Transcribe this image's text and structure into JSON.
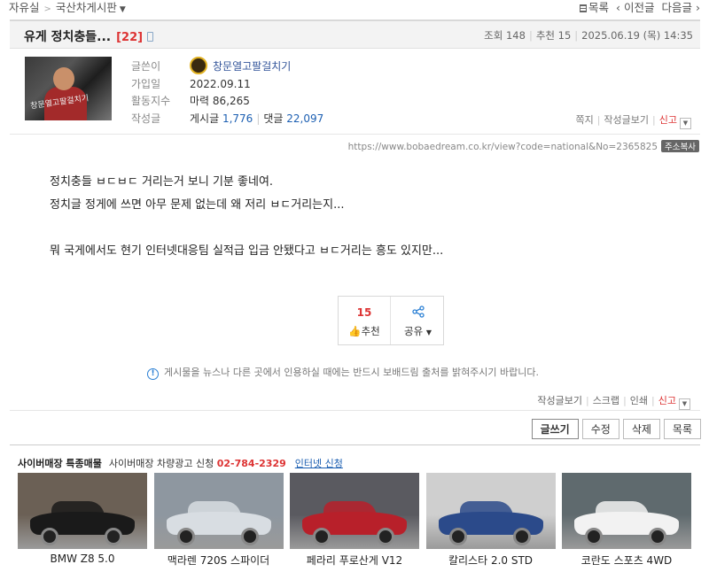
{
  "breadcrumb": {
    "root": "자유실",
    "board": "국산차게시판"
  },
  "topnav": {
    "list": "목록",
    "prev": "이전글",
    "next": "다음글"
  },
  "post": {
    "title": "유게 정치충들...",
    "comment_count": "[22]",
    "views": "조회 148",
    "recommends": "추천 15",
    "date": "2025.06.19 (목) 14:35"
  },
  "author": {
    "avatar_caption": "창문열고팔걸치기",
    "labels": {
      "writer": "글쓴이",
      "joined": "가입일",
      "activity": "활동지수",
      "posts": "작성글"
    },
    "nickname": "창문열고팔걸치기",
    "joined": "2022.09.11",
    "activity_label": "마력",
    "activity_value": "86,265",
    "posts_label": "게시글",
    "posts_value": "1,776",
    "comments_label": "댓글",
    "comments_value": "22,097",
    "links": {
      "note": "쪽지",
      "view_posts": "작성글보기",
      "report": "신고"
    }
  },
  "url": {
    "text": "https://www.bobaedream.co.kr/view?code=national&No=2365825",
    "copy": "주소복사"
  },
  "content": {
    "line1": "정치충들 ㅂㄷㅂㄷ 거리는거 보니 기분 좋네여.",
    "line2": "정치글 정게에 쓰면 아무 문제 없는데 왜 저리 ㅂㄷ거리는지...",
    "line3": "뭐 국게에서도 현기 인터넷대응팀 실적급 입금 안됐다고 ㅂㄷ거리는 흥도 있지만..."
  },
  "vote": {
    "count": "15",
    "label": "추천",
    "share": "공유"
  },
  "notice": "게시물을 뉴스나 다른 곳에서 인용하실 때에는 반드시 보배드림 출처를 밝혀주시기 바랍니다.",
  "bottom_links": {
    "view_posts": "작성글보기",
    "scrap": "스크랩",
    "print": "인쇄",
    "report": "신고"
  },
  "actions": {
    "write": "글쓰기",
    "edit": "수정",
    "delete": "삭제",
    "list": "목록"
  },
  "market": {
    "title": "사이버매장 특종매물",
    "ad": "사이버매장 차량광고 신청",
    "phone": "02-784-2329",
    "apply": "인터넷 신청",
    "cars": [
      {
        "name": "BMW Z8 5.0",
        "color": "#1a1a1a",
        "bg": "#6b6055"
      },
      {
        "name": "맥라렌 720S 스파이더",
        "color": "#d8dde2",
        "bg": "#8e97a0"
      },
      {
        "name": "페라리 푸로산게 V12",
        "color": "#b8202a",
        "bg": "#5a5a60"
      },
      {
        "name": "칼리스타 2.0 STD",
        "color": "#2b4a8a",
        "bg": "#cfcfcf"
      },
      {
        "name": "코란도 스포츠 4WD",
        "color": "#f2f2f2",
        "bg": "#5f6a6e"
      }
    ]
  },
  "colors": {
    "accent_red": "#d33",
    "link_blue": "#1c5fb2"
  }
}
